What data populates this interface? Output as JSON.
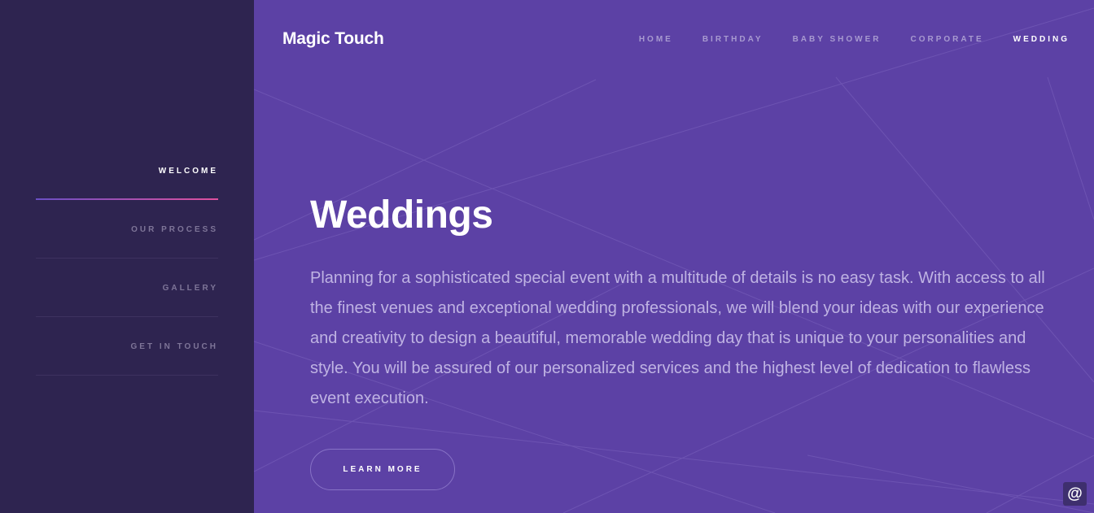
{
  "sidebar": {
    "items": [
      {
        "label": "WELCOME",
        "active": true
      },
      {
        "label": "OUR PROCESS",
        "active": false
      },
      {
        "label": "GALLERY",
        "active": false
      },
      {
        "label": "GET IN TOUCH",
        "active": false
      }
    ]
  },
  "header": {
    "brand": "Magic Touch",
    "nav": [
      {
        "label": "HOME"
      },
      {
        "label": "BIRTHDAY"
      },
      {
        "label": "BABY SHOWER"
      },
      {
        "label": "CORPORATE"
      },
      {
        "label": "WEDDING",
        "active": true
      }
    ]
  },
  "hero": {
    "title": "Weddings",
    "body": "Planning for a sophisticated special event with a multitude of details is no easy task. With access to all the finest venues and exceptional wedding professionals, we will blend your ideas with our experience and creativity to design a beautiful, memorable wedding day that is unique to your personalities and style. You will be assured of our personalized services and the highest level of dedication to flawless event execution.",
    "button": "LEARN MORE"
  },
  "widget": {
    "icon": "at-sign-icon",
    "glyph": "@"
  },
  "colors": {
    "sidebar_bg": "#2e2450",
    "main_bg": "#5c41a5",
    "accent_gradient_start": "#6a4fc4",
    "accent_gradient_end": "#e0509f"
  }
}
